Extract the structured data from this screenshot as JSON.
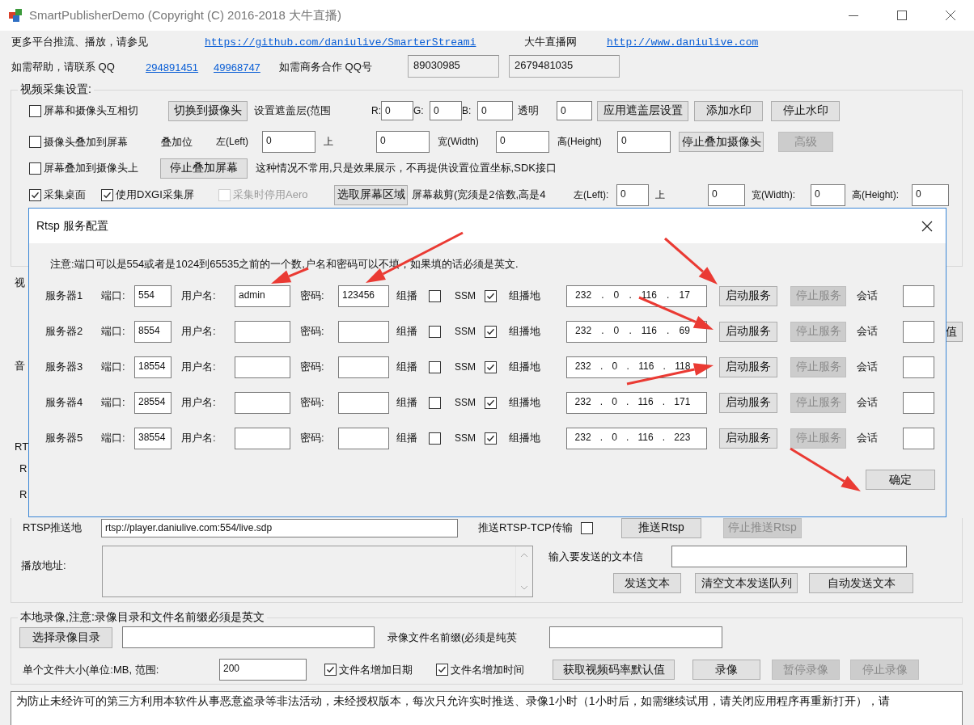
{
  "window": {
    "title": "SmartPublisherDemo  (Copyright (C) 2016-2018 大牛直播)"
  },
  "header": {
    "more_label": "更多平台推流、播放，请参见",
    "github_link": "https://github.com/daniulive/SmarterStreami",
    "site_label": "大牛直播网",
    "site_link": "http://www.daniulive.com",
    "help_label": "如需帮助，请联系 QQ",
    "qq_links": [
      "294891451",
      "49968747"
    ],
    "business_label": "如需商务合作 QQ号",
    "business_qq": [
      "89030985",
      "2679481035"
    ]
  },
  "video_capture": {
    "title": "视频采集设置:",
    "switch_row": {
      "checkbox": {
        "label": "屏幕和摄像头互相切",
        "checked": false
      },
      "button": {
        "label": "切换到摄像头",
        "disabled": false
      },
      "mask_label": "设置遮盖层(范围",
      "colors": [
        {
          "label": "R:",
          "value": "0"
        },
        {
          "label": "G:",
          "value": "0"
        },
        {
          "label": "B:",
          "value": "0"
        }
      ],
      "alpha_label": "透明",
      "alpha_value": "0",
      "buttons": [
        {
          "label": "应用遮盖层设置",
          "disabled": false
        },
        {
          "label": "添加水印",
          "disabled": false
        },
        {
          "label": "停止水印",
          "disabled": false
        }
      ]
    },
    "camera_row": {
      "checkbox": {
        "label": "摄像头叠加到屏幕",
        "checked": false
      },
      "position_label": "叠加位",
      "fields": [
        {
          "label": "左(Left)",
          "value": "0"
        },
        {
          "label": "上",
          "value": "0"
        },
        {
          "label": "宽(Width)",
          "value": "0"
        },
        {
          "label": "高(Height)",
          "value": "0"
        }
      ],
      "buttons": [
        {
          "label": "停止叠加摄像头",
          "disabled": false
        },
        {
          "label": "高级",
          "disabled": true
        }
      ]
    },
    "screen_row": {
      "checkbox": {
        "label": "屏幕叠加到摄像头上",
        "checked": false
      },
      "button": {
        "label": "停止叠加屏幕",
        "disabled": false
      },
      "note": "这种情况不常用,只是效果展示，不再提供设置位置坐标,SDK接口"
    },
    "desktop_row": {
      "checkboxes": [
        {
          "label": "采集桌面",
          "checked": true,
          "disabled": false
        },
        {
          "label": "使用DXGI采集屏",
          "checked": true,
          "disabled": false
        },
        {
          "label": "采集时停用Aero",
          "checked": false,
          "disabled": true
        }
      ],
      "button": {
        "label": "选取屏幕区域",
        "disabled": false
      },
      "crop_label": "屏幕裁剪(宽须是2倍数,高是4",
      "fields": [
        {
          "label": "左(Left):",
          "value": "0"
        },
        {
          "label": "上",
          "value": "0"
        },
        {
          "label": "宽(Width):",
          "value": "0"
        },
        {
          "label": "高(Height):",
          "value": "0"
        }
      ]
    }
  },
  "covered": {
    "labels": [
      "视",
      "音",
      "RT",
      "R",
      "R"
    ],
    "button": "值"
  },
  "rtsp_push": {
    "address_label": "RTSP推送地",
    "address": "rtsp://player.daniulive.com:554/live.sdp",
    "tcp_label": "推送RTSP-TCP传输",
    "tcp_checked": false,
    "buttons": [
      {
        "label": "推送Rtsp",
        "disabled": false
      },
      {
        "label": "停止推送Rtsp",
        "disabled": true
      }
    ],
    "play_label": "播放地址:",
    "text_label": "输入要发送的文本信",
    "text_buttons": [
      {
        "label": "发送文本",
        "disabled": false
      },
      {
        "label": "清空文本发送队列",
        "disabled": false
      },
      {
        "label": "自动发送文本",
        "disabled": false
      }
    ]
  },
  "recording": {
    "title": "本地录像,注意:录像目录和文件名前缀必须是英文",
    "dir_button": {
      "label": "选择录像目录",
      "disabled": false
    },
    "prefix_label": "录像文件名前缀(必须是纯英",
    "size_label": "单个文件大小(单位:MB, 范围:",
    "size_value": "200",
    "checkboxes": [
      {
        "label": "文件名增加日期",
        "checked": true
      },
      {
        "label": "文件名增加时间",
        "checked": true
      }
    ],
    "buttons": [
      {
        "label": "获取视频码率默认值",
        "disabled": false
      },
      {
        "label": "录像",
        "disabled": false
      },
      {
        "label": "暂停录像",
        "disabled": true
      },
      {
        "label": "停止录像",
        "disabled": true
      }
    ]
  },
  "notice": "为防止未经许可的第三方利用本软件从事恶意盗录等非法活动，未经授权版本，每次只允许实时推送、录像1小时（1小时后，如需继续试用，请关闭应用程序再重新打开），请",
  "dialog": {
    "title": "Rtsp 服务配置",
    "note": "注意:端口可以是554或者是1024到65535之前的一个数,户名和密码可以不填，如果填的话必须是英文.",
    "ip_separator": ".",
    "servers": [
      {
        "name": "服务器1",
        "port_label": "端口:",
        "port": "554",
        "user_label": "用户名:",
        "user": "admin",
        "password_label": "密码:",
        "password": "123456",
        "multicast_label": "组播",
        "multicast": false,
        "ssm_label": "SSM",
        "ssm": true,
        "address_label": "组播地",
        "address": [
          "232",
          "0",
          "116",
          "17"
        ],
        "start": {
          "label": "启动服务",
          "disabled": false
        },
        "stop": {
          "label": "停止服务",
          "disabled": true
        },
        "session_label": "会话"
      },
      {
        "name": "服务器2",
        "port_label": "端口:",
        "port": "8554",
        "user_label": "用户名:",
        "password_label": "密码:",
        "multicast_label": "组播",
        "multicast": false,
        "ssm_label": "SSM",
        "ssm": true,
        "address_label": "组播地",
        "address": [
          "232",
          "0",
          "116",
          "69"
        ],
        "start": {
          "label": "启动服务",
          "disabled": false
        },
        "stop": {
          "label": "停止服务",
          "disabled": true
        },
        "session_label": "会话"
      },
      {
        "name": "服务器3",
        "port_label": "端口:",
        "port": "18554",
        "user_label": "用户名:",
        "password_label": "密码:",
        "multicast_label": "组播",
        "multicast": false,
        "ssm_label": "SSM",
        "ssm": true,
        "address_label": "组播地",
        "address": [
          "232",
          "0",
          "116",
          "118"
        ],
        "start": {
          "label": "启动服务",
          "disabled": false
        },
        "stop": {
          "label": "停止服务",
          "disabled": true
        },
        "session_label": "会话"
      },
      {
        "name": "服务器4",
        "port_label": "端口:",
        "port": "28554",
        "user_label": "用户名:",
        "password_label": "密码:",
        "multicast_label": "组播",
        "multicast": false,
        "ssm_label": "SSM",
        "ssm": true,
        "address_label": "组播地",
        "address": [
          "232",
          "0",
          "116",
          "171"
        ],
        "start": {
          "label": "启动服务",
          "disabled": false
        },
        "stop": {
          "label": "停止服务",
          "disabled": true
        },
        "session_label": "会话"
      },
      {
        "name": "服务器5",
        "port_label": "端口:",
        "port": "38554",
        "user_label": "用户名:",
        "password_label": "密码:",
        "multicast_label": "组播",
        "multicast": false,
        "ssm_label": "SSM",
        "ssm": true,
        "address_label": "组播地",
        "address": [
          "232",
          "0",
          "116",
          "223"
        ],
        "start": {
          "label": "启动服务",
          "disabled": false
        },
        "stop": {
          "label": "停止服务",
          "disabled": true
        },
        "session_label": "会话"
      }
    ],
    "ok_button": "确定"
  }
}
